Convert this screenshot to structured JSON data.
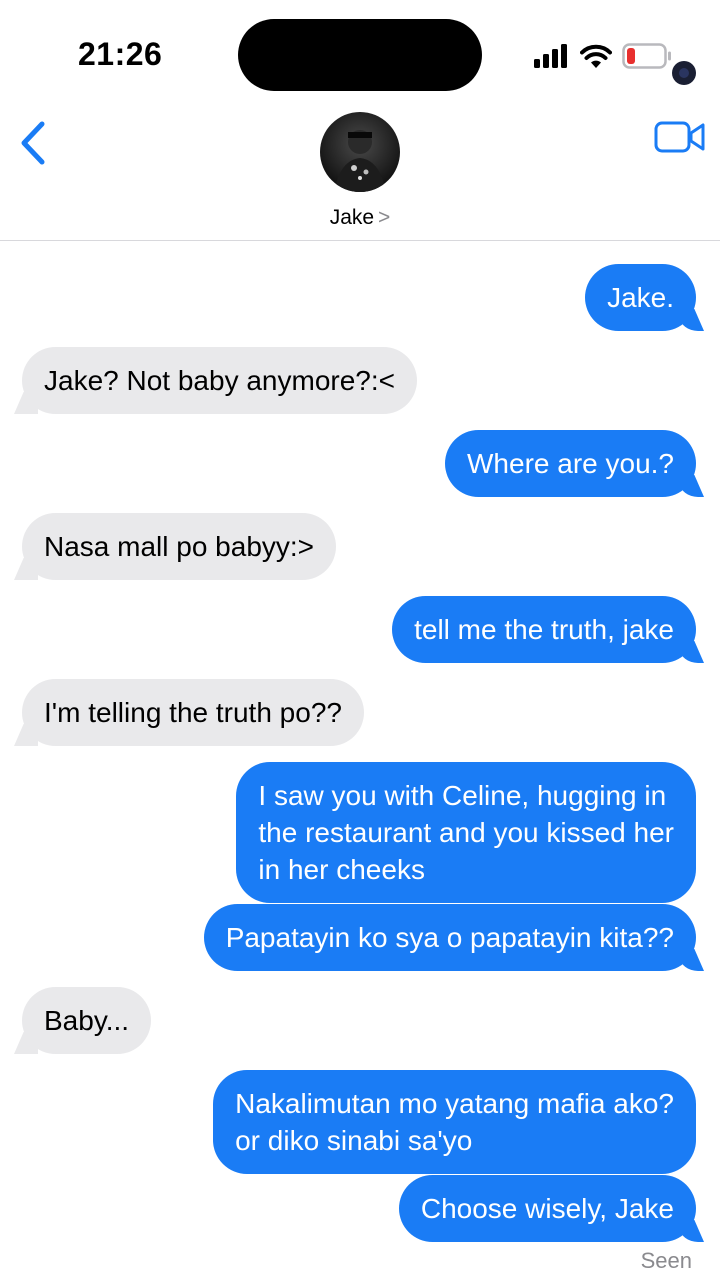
{
  "status": {
    "time": "21:26"
  },
  "header": {
    "contact_name": "Jake",
    "chevron": ">"
  },
  "messages": [
    {
      "from": "me",
      "text": "Jake."
    },
    {
      "from": "them",
      "text": "Jake? Not baby anymore?:<"
    },
    {
      "from": "me",
      "text": "Where are you.?"
    },
    {
      "from": "them",
      "text": "Nasa mall po babyy:>"
    },
    {
      "from": "me",
      "text": "tell me the truth, jake"
    },
    {
      "from": "them",
      "text": "I'm telling the truth po??"
    },
    {
      "from": "me",
      "lines": [
        "I saw you with Celine, hugging in",
        "the restaurant and you kissed her",
        "in her cheeks"
      ]
    },
    {
      "from": "me",
      "text": "Papatayin ko sya o papatayin kita??"
    },
    {
      "from": "them",
      "text": "Baby..."
    },
    {
      "from": "me",
      "lines": [
        "Nakalimutan mo yatang mafia ako?",
        "or diko sinabi sa'yo"
      ]
    },
    {
      "from": "me",
      "text": "Choose wisely, Jake"
    }
  ],
  "receipt": "Seen",
  "colors": {
    "accent": "#1a7cf5",
    "received_bubble": "#e9e9eb",
    "battery_low": "#e8302f"
  },
  "icons": [
    "back-chevron-icon",
    "video-camera-icon",
    "signal-icon",
    "wifi-icon",
    "battery-icon"
  ]
}
